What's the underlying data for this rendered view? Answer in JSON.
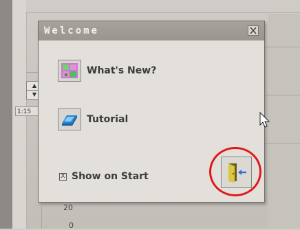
{
  "dialog": {
    "title": "Welcome",
    "items": [
      {
        "label": "What's New?",
        "icon": "whats-new-icon"
      },
      {
        "label": "Tutorial",
        "icon": "tutorial-icon"
      }
    ],
    "show_on_start": {
      "label": "Show on Start",
      "checked": true,
      "mark": "X"
    },
    "exit_icon": "exit-door-icon",
    "close_icon": "close-icon"
  },
  "background": {
    "ruler_box": "1:15",
    "ruler_tick": "20",
    "ruler_tick_bottom": "0",
    "spin_up": "▲",
    "spin_down": "▼"
  },
  "colors": {
    "annotation_ring": "#e01818",
    "titlebar": "#9a958f"
  }
}
